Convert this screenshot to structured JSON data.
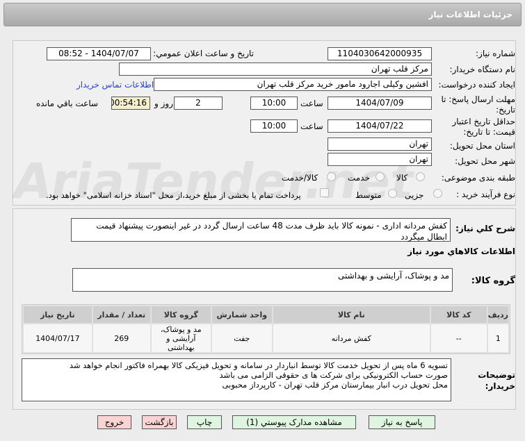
{
  "header": {
    "title": "جزئیات اطلاعات نیاز"
  },
  "watermark": "AriaTender.net",
  "form": {
    "need_number_label": "شماره نیاز:",
    "need_number": "1104030642000935",
    "announce_label": "تاریخ و ساعت اعلان عمومي:",
    "announce_value": "1404/07/07 - 08:52",
    "buyer_org_label": "نام دستگاه خریدار:",
    "buyer_org": "مرکز قلب تهران",
    "creator_label": "ایجاد کننده درخواست:",
    "creator": "افشین وکیلی اجارود مامور خرید مرکز قلب تهران",
    "contact_link": "اطلاعات تماس خریدار",
    "deadline_label": "مهلت ارسال پاسخ: تا تاریخ:",
    "deadline_date": "1404/07/09",
    "time_label": "ساعت",
    "deadline_time": "10:00",
    "days": "2",
    "days_label": "روز و",
    "remaining": "00:54:16",
    "remaining_label": "ساعت باقي مانده",
    "validity_label": "حداقل تاریخ اعتبار قیمت: تا تاریخ:",
    "validity_date": "1404/07/22",
    "validity_time": "10:00",
    "province_label": "استان محل تحویل:",
    "province": "تهران",
    "city_label": "شهر محل تحویل:",
    "city": "تهران",
    "category_label": "طبقه بندی موضوعی:",
    "category_options": [
      "کالا",
      "خدمت",
      "کالا/خدمت"
    ],
    "process_label": "نوع فرآیند خرید :",
    "process_options": [
      "جزیی",
      "متوسط"
    ],
    "payment_note": "پرداخت تمام یا بخشی از مبلغ خرید،از محل \"اسناد خزانه اسلامی\" خواهد بود."
  },
  "details": {
    "desc_label": "شرح کلي نياز:",
    "desc": "کفش مردانه اداری - نمونه کالا باید ظرف مدت 48 ساعت ارسال گردد  در غیر اینصورت پیشنهاد قیمت ابطال میگردد",
    "goods_info_title": "اطلاعات کالاهاي مورد نياز",
    "group_label": "گروه کالا:",
    "group": "مد و پوشاک، آرایشی و بهداشتی",
    "table": {
      "headers": [
        "ردیف",
        "کد کالا",
        "نام کالا",
        "واحد شمارش",
        "گروه کالا",
        "تعداد / مقدار",
        "تاریخ نیاز"
      ],
      "rows": [
        [
          "1",
          "--",
          "کفش مردانه",
          "جفت",
          "مد و پوشاک، آرایشی و بهداشتی",
          "269",
          "1404/07/17"
        ]
      ]
    },
    "notes_label": "توضیحات خریدار:",
    "notes": [
      "تسویه 6 ماه پس از تحویل خدمت کالا توسط انباردار در سامانه و تحویل فیزیکی کالا بهمراه فاکتور انجام خواهد شد",
      "صورت حساب الکترونیکی برای شرکت ها ی حقوقی الزامی می باشد",
      "محل تحویل درب انبار بیمارستان مرکز قلب تهران - کارپرداز محبوبی"
    ]
  },
  "buttons": {
    "reply": "پاسخ به نیاز",
    "attachments": "مشاهده مدارک پیوستي (1)",
    "print": "چاپ",
    "back": "بازگشت",
    "exit": "خروج"
  }
}
